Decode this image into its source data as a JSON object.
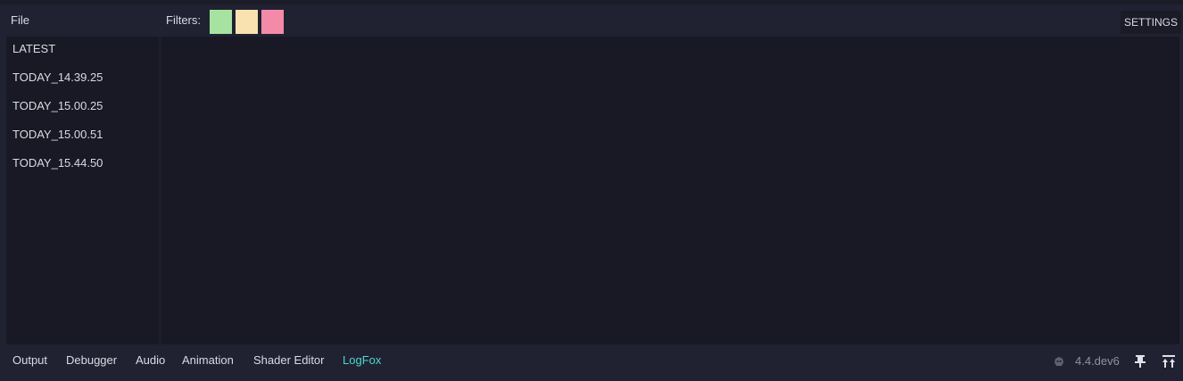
{
  "header": {
    "file_menu": "File",
    "filters_label": "Filters:",
    "settings_button": "SETTINGS"
  },
  "filters": [
    {
      "name": "green-filter",
      "color": "#a6e3a1"
    },
    {
      "name": "yellow-filter",
      "color": "#f9e2af"
    },
    {
      "name": "pink-filter",
      "color": "#f38ba8"
    }
  ],
  "sidebar": {
    "items": [
      {
        "label": "LATEST"
      },
      {
        "label": "TODAY_14.39.25"
      },
      {
        "label": "TODAY_15.00.25"
      },
      {
        "label": "TODAY_15.00.51"
      },
      {
        "label": "TODAY_15.44.50"
      }
    ]
  },
  "bottom_panel": {
    "tabs": [
      {
        "label": "Output",
        "active": false
      },
      {
        "label": "Debugger",
        "active": false
      },
      {
        "label": "Audio",
        "active": false
      },
      {
        "label": "Animation",
        "active": false
      },
      {
        "label": "Shader Editor",
        "active": false
      },
      {
        "label": "LogFox",
        "active": true
      }
    ],
    "version": "4.4.dev6",
    "version_icon": "godot-icon",
    "pin_icon": "pin-icon",
    "expand_icon": "expand-panel-icon"
  },
  "colors": {
    "accent": "#4fd6d0",
    "background": "#202232",
    "panel": "#181924"
  }
}
